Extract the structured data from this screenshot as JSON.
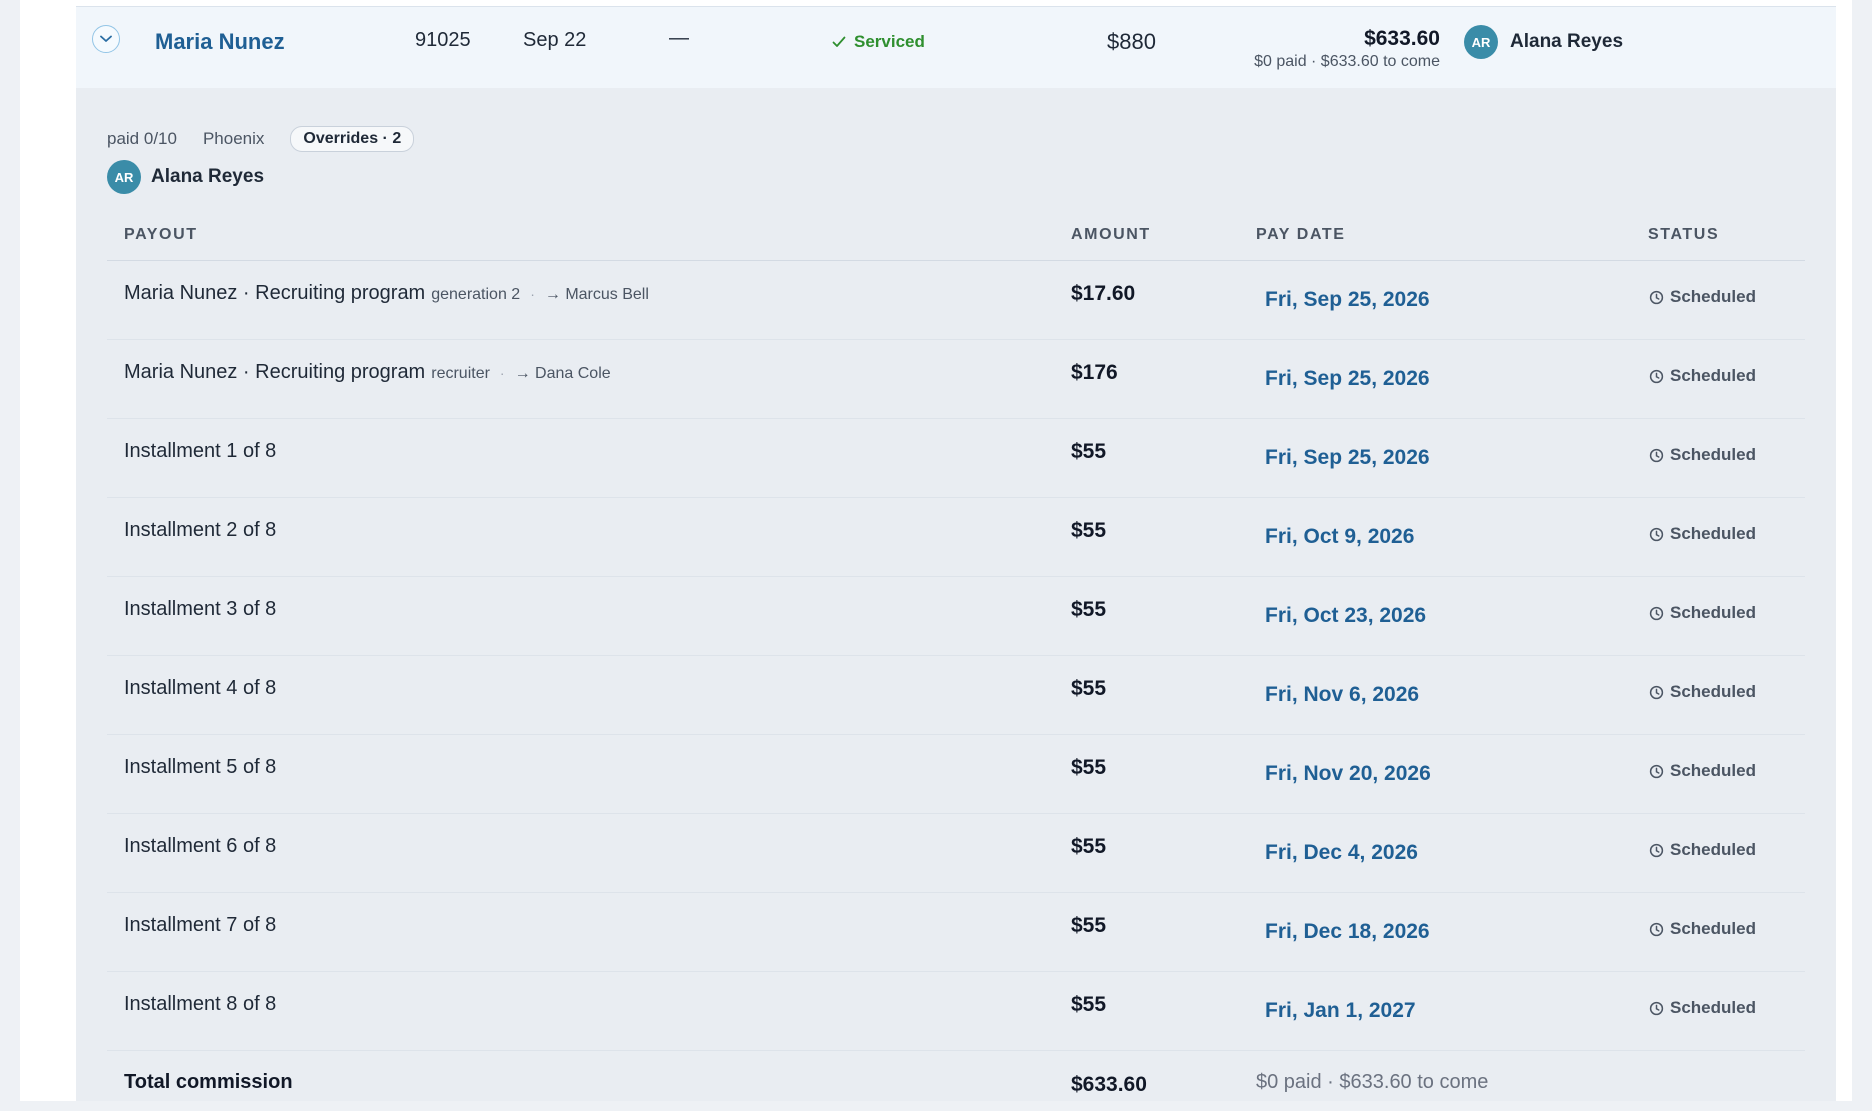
{
  "row": {
    "client": "Maria Nunez",
    "zip": "91025",
    "date": "Sep 22",
    "dash": "—",
    "status": "Serviced",
    "price": "$880",
    "commission_total": "$633.60",
    "commission_sub": "$0 paid · $633.60 to come",
    "rep_initials": "AR",
    "rep_name": "Alana Reyes"
  },
  "detail": {
    "paid": "paid 0/10",
    "location": "Phoenix",
    "overrides_badge": "Overrides · 2",
    "owner_initials": "AR",
    "owner_name": "Alana Reyes"
  },
  "table": {
    "headers": {
      "payout": "PAYOUT",
      "amount": "AMOUNT",
      "pay_date": "PAY DATE",
      "status": "STATUS"
    },
    "rows": [
      {
        "payout": "Maria Nunez · Recruiting program",
        "tag": "generation 2",
        "to": "→ Marcus Bell",
        "amount": "$17.60",
        "date": "Fri, Sep 25, 2026",
        "status": "Scheduled"
      },
      {
        "payout": "Maria Nunez · Recruiting program",
        "tag": "recruiter",
        "to": "→ Dana Cole",
        "amount": "$176",
        "date": "Fri, Sep 25, 2026",
        "status": "Scheduled"
      },
      {
        "payout": "Installment 1 of 8",
        "amount": "$55",
        "date": "Fri, Sep 25, 2026",
        "status": "Scheduled"
      },
      {
        "payout": "Installment 2 of 8",
        "amount": "$55",
        "date": "Fri, Oct 9, 2026",
        "status": "Scheduled"
      },
      {
        "payout": "Installment 3 of 8",
        "amount": "$55",
        "date": "Fri, Oct 23, 2026",
        "status": "Scheduled"
      },
      {
        "payout": "Installment 4 of 8",
        "amount": "$55",
        "date": "Fri, Nov 6, 2026",
        "status": "Scheduled"
      },
      {
        "payout": "Installment 5 of 8",
        "amount": "$55",
        "date": "Fri, Nov 20, 2026",
        "status": "Scheduled"
      },
      {
        "payout": "Installment 6 of 8",
        "amount": "$55",
        "date": "Fri, Dec 4, 2026",
        "status": "Scheduled"
      },
      {
        "payout": "Installment 7 of 8",
        "amount": "$55",
        "date": "Fri, Dec 18, 2026",
        "status": "Scheduled"
      },
      {
        "payout": "Installment 8 of 8",
        "amount": "$55",
        "date": "Fri, Jan 1, 2027",
        "status": "Scheduled"
      }
    ],
    "footer": {
      "label": "Total commission",
      "amount": "$633.60",
      "sub": "$0 paid · $633.60 to come"
    }
  },
  "colors": {
    "link": "#1f5f94",
    "serviced": "#2f8f2f",
    "avatar": "#3a8ca8"
  }
}
